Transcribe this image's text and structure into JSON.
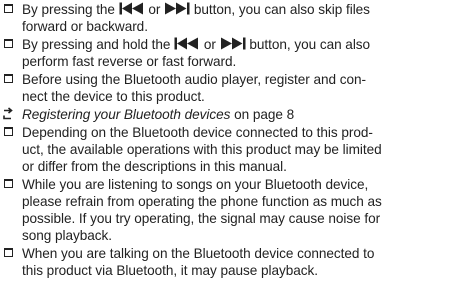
{
  "items": [
    {
      "before": "By pressing the",
      "or": "or",
      "after": "button, you can also skip files",
      "line2": "forward or backward."
    },
    {
      "before": "By pressing and hold the",
      "or": "or",
      "after": "button, you can also",
      "line2": "perform fast reverse or fast forward."
    },
    {
      "line1": "Before using the Bluetooth audio player, register and con-",
      "line2": "nect the device to this product."
    },
    {
      "ref_title": "Registering your Bluetooth devices",
      "ref_suffix": "on page 8"
    },
    {
      "line1": "Depending on the Bluetooth device connected to this prod-",
      "line2": "uct, the available operations with this product may be limited",
      "line3": "or differ from the descriptions in this manual."
    },
    {
      "line1": "While you are listening to songs on your Bluetooth device,",
      "line2": "please refrain from operating the phone function as much as",
      "line3": "possible. If you try operating, the signal may cause noise for",
      "line4": "song playback."
    },
    {
      "line1": "When you are talking on the Bluetooth device connected to",
      "line2": "this product via Bluetooth, it may pause playback."
    }
  ],
  "icons": {
    "bullet": "checkbox-bullet",
    "reference": "arrow-reference",
    "previous": "skip-previous",
    "next": "skip-next"
  }
}
